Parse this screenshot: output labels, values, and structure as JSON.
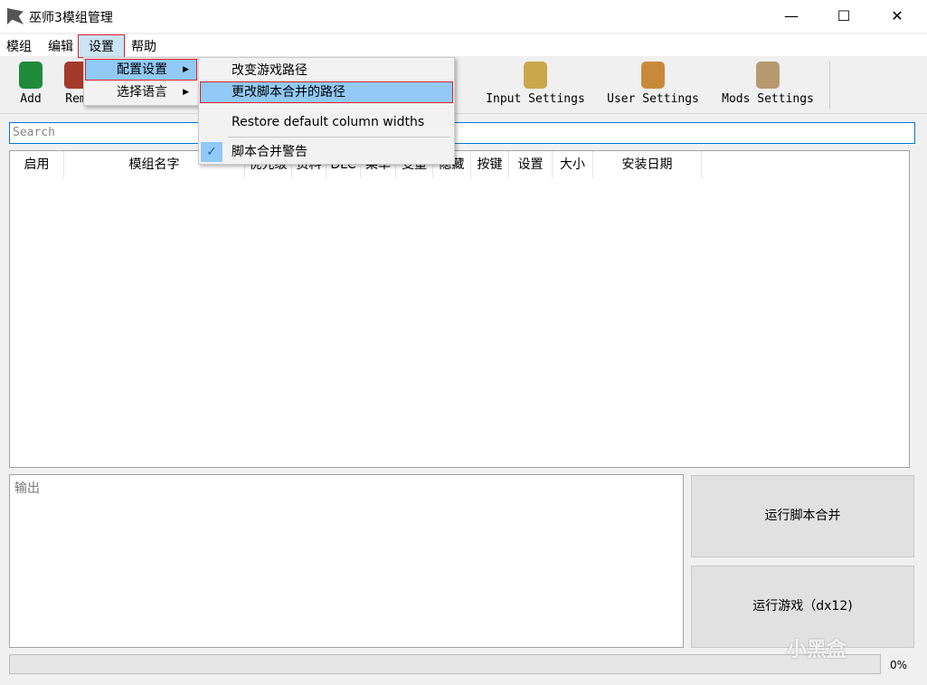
{
  "window": {
    "title": "巫师3模组管理",
    "minimize": "—",
    "maximize": "☐",
    "close": "✕"
  },
  "menubar": [
    "模组",
    "编辑",
    "设置",
    "帮助"
  ],
  "toolbar": [
    {
      "label": "Add",
      "color": "#1f8a3a"
    },
    {
      "label": "Rem",
      "color": "#a33a2a"
    },
    {
      "label": "Input Settings",
      "color": "#c9a84a"
    },
    {
      "label": "User Settings",
      "color": "#c88a3a"
    },
    {
      "label": "Mods Settings",
      "color": "#b89a70"
    }
  ],
  "search": {
    "placeholder": "Search"
  },
  "table": {
    "columns": [
      "启用",
      "模组名字",
      "优先级",
      "资料",
      "DLC",
      "菜单",
      "变量",
      "隐藏",
      "按键",
      "设置",
      "大小",
      "安装日期"
    ]
  },
  "output": {
    "placeholder": "输出"
  },
  "buttons": {
    "merge": "运行脚本合并",
    "run": "运行游戏（dx12)"
  },
  "progress": {
    "value": 0,
    "label": "0%"
  },
  "settings_menu": {
    "items": [
      "配置设置",
      "选择语言"
    ]
  },
  "config_submenu": {
    "items": [
      "改变游戏路径",
      "更改脚本合并的路径",
      "Restore default column widths",
      "脚本合并警告"
    ],
    "checked_item": "脚本合并警告",
    "check": "✓"
  },
  "watermark": "小黑盒"
}
